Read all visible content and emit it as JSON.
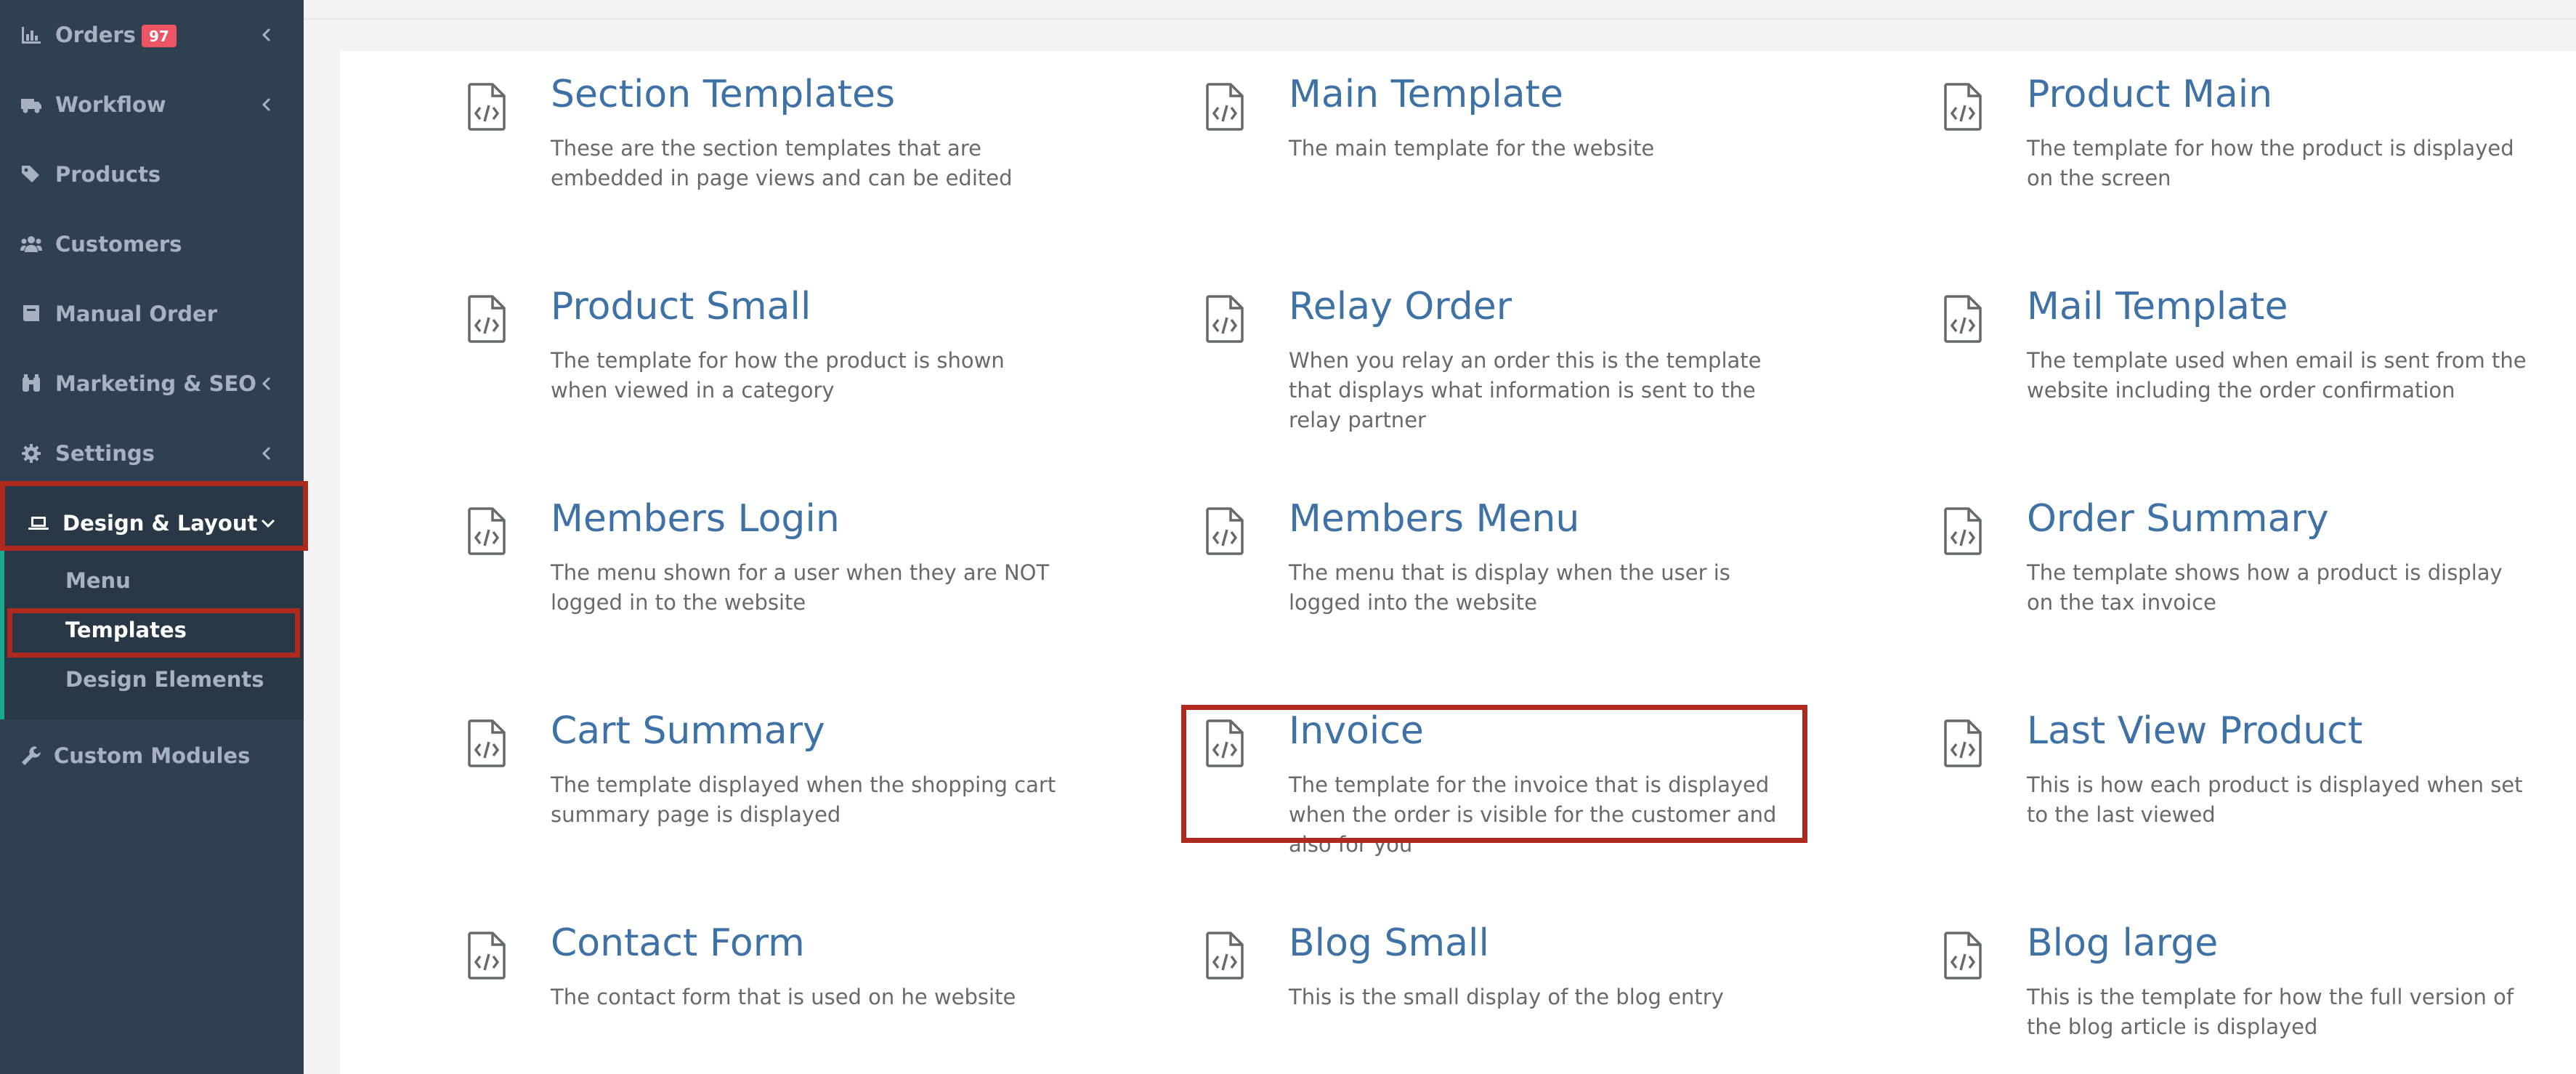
{
  "sidebar": {
    "items": [
      {
        "label": "Orders",
        "icon": "bar-chart-icon",
        "badge": "97",
        "has_chevron": true
      },
      {
        "label": "Workflow",
        "icon": "truck-icon",
        "has_chevron": true
      },
      {
        "label": "Products",
        "icon": "tags-icon",
        "has_chevron": false
      },
      {
        "label": "Customers",
        "icon": "users-icon",
        "has_chevron": false
      },
      {
        "label": "Manual Order",
        "icon": "book-icon",
        "has_chevron": false
      },
      {
        "label": "Marketing & SEO",
        "icon": "binoculars-icon",
        "has_chevron": true
      },
      {
        "label": "Settings",
        "icon": "gear-icon",
        "has_chevron": true
      },
      {
        "label": "Design & Layout",
        "icon": "laptop-icon",
        "has_chevron": true,
        "expanded": true
      },
      {
        "label": "Custom Modules",
        "icon": "wrench-icon",
        "has_chevron": false
      }
    ],
    "subitems": [
      {
        "label": "Menu"
      },
      {
        "label": "Templates",
        "current": true
      },
      {
        "label": "Design Elements"
      }
    ],
    "badge_color": "#ed5565"
  },
  "templates": [
    {
      "title": "Section Templates",
      "description": "These are the section templates that are embedded in page views and can be edited"
    },
    {
      "title": "Main Template",
      "description": "The main template for the website"
    },
    {
      "title": "Product Main",
      "description": "The template for how the product is displayed on the screen"
    },
    {
      "title": "Product Small",
      "description": "The template for how the product is shown when viewed in a category"
    },
    {
      "title": "Relay Order",
      "description": "When you relay an order this is the template that displays what information is sent to the relay partner"
    },
    {
      "title": "Mail Template",
      "description": "The template used when email is sent from the website including the order confirmation"
    },
    {
      "title": "Members Login",
      "description": "The menu shown for a user when they are NOT logged in to the website"
    },
    {
      "title": "Members Menu",
      "description": "The menu that is display when the user is logged into the website"
    },
    {
      "title": "Order Summary",
      "description": "The template shows how a product is display on the tax invoice"
    },
    {
      "title": "Cart Summary",
      "description": "The template displayed when the shopping cart summary page is displayed"
    },
    {
      "title": "Invoice",
      "description": "The template for the invoice that is displayed when the order is visible for the customer and also for you",
      "highlighted": true
    },
    {
      "title": "Last View Product",
      "description": "This is how each product is displayed when set to the last viewed"
    },
    {
      "title": "Contact Form",
      "description": "The contact form that is used on he website"
    },
    {
      "title": "Blog Small",
      "description": "This is the small display of the blog entry"
    },
    {
      "title": "Blog large",
      "description": "This is the template for how the full version of the blog article is displayed"
    }
  ],
  "template_icon": "file-code-icon",
  "colors": {
    "sidebar_bg": "#2f4050",
    "link_blue": "#3e71a5",
    "highlight_red": "#ae2a1e"
  }
}
